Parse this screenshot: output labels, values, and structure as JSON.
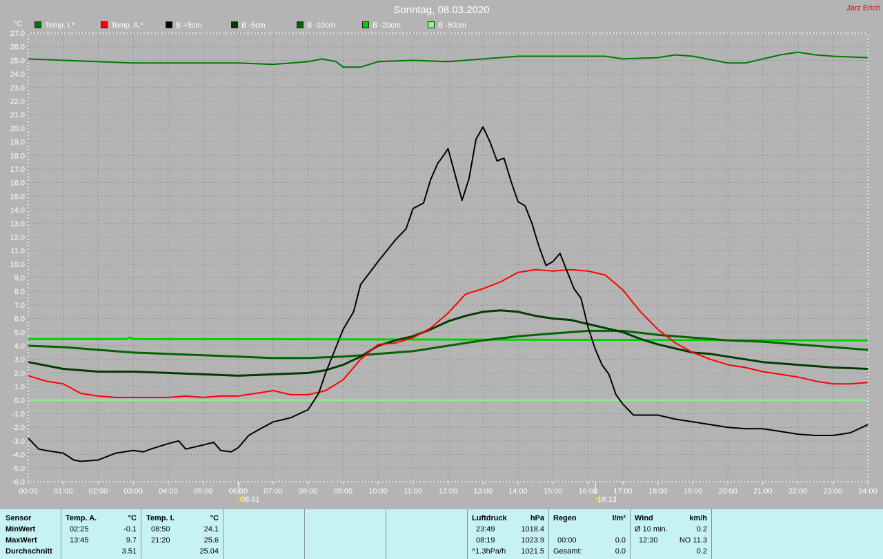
{
  "title": "Sonntag, 08.03.2020",
  "author": "Jarz Erich",
  "chart_data": {
    "type": "line",
    "ylabel": "°C",
    "ylim": [
      -6,
      27
    ],
    "yticks": [
      "27.0",
      "26.0",
      "25.0",
      "24.0",
      "23.0",
      "22.0",
      "21.0",
      "20.0",
      "19.0",
      "18.0",
      "17.0",
      "16.0",
      "15.0",
      "14.0",
      "13.0",
      "12.0",
      "11.0",
      "10.0",
      "9.0",
      "8.0",
      "7.0",
      "6.0",
      "5.0",
      "4.0",
      "3.0",
      "2.0",
      "1.0",
      "0.0",
      "-1.0",
      "-2.0",
      "-3.0",
      "-4.0",
      "-5.0",
      "-6.0"
    ],
    "xlim": [
      0,
      24
    ],
    "xticks": [
      "00:00",
      "01:00",
      "02:00",
      "03:00",
      "04:00",
      "05:00",
      "06:00",
      "07:00",
      "08:00",
      "09:00",
      "10:00",
      "11:00",
      "12:00",
      "13:00",
      "14:00",
      "15:00",
      "16:00",
      "17:00",
      "18:00",
      "19:00",
      "20:00",
      "21:00",
      "22:00",
      "23:00",
      "24:00"
    ],
    "grid": true,
    "sunrise": "06:01",
    "sunset": "16:13",
    "legend": [
      {
        "name": "Temp. I.*",
        "color": "#007800"
      },
      {
        "name": "Temp. A.*",
        "color": "#ff0000"
      },
      {
        "name": "B +5cm",
        "color": "#000000"
      },
      {
        "name": "B -5cm",
        "color": "#003c00"
      },
      {
        "name": "B -10cm",
        "color": "#006400"
      },
      {
        "name": "B -20cm",
        "color": "#00d000"
      },
      {
        "name": "B -50cm",
        "color": "#80ff80"
      }
    ],
    "series": [
      {
        "name": "Temp. I.*",
        "color": "#007800",
        "width": 2,
        "x": [
          0,
          1,
          2,
          3,
          4,
          5,
          6,
          7,
          8,
          8.4,
          8.8,
          9,
          9.5,
          10,
          11,
          12,
          12.5,
          13,
          14,
          15,
          16,
          16.5,
          17,
          18,
          18.5,
          19,
          20,
          20.5,
          21,
          21.5,
          22,
          22.5,
          23,
          24
        ],
        "values": [
          25.1,
          25,
          24.9,
          24.8,
          24.8,
          24.8,
          24.8,
          24.7,
          24.9,
          25.1,
          24.9,
          24.5,
          24.5,
          24.9,
          25,
          24.9,
          25,
          25.1,
          25.3,
          25.3,
          25.3,
          25.3,
          25.1,
          25.2,
          25.4,
          25.3,
          24.8,
          24.8,
          25.1,
          25.4,
          25.6,
          25.4,
          25.3,
          25.2
        ]
      },
      {
        "name": "Temp. A.*",
        "color": "#ff0000",
        "width": 2,
        "x": [
          0,
          0.5,
          1,
          1.5,
          2,
          2.5,
          3,
          3.5,
          4,
          4.5,
          5,
          5.5,
          6,
          6.5,
          7,
          7.5,
          8,
          8.5,
          9,
          9.5,
          10,
          10.5,
          11,
          11.5,
          12,
          12.5,
          13,
          13.5,
          14,
          14.5,
          15,
          15.5,
          16,
          16.5,
          17,
          17.5,
          18,
          18.5,
          19,
          19.5,
          20,
          20.5,
          21,
          21.5,
          22,
          22.5,
          23,
          23.5,
          24
        ],
        "values": [
          1.8,
          1.4,
          1.2,
          0.5,
          0.3,
          0.2,
          0.2,
          0.2,
          0.2,
          0.3,
          0.2,
          0.3,
          0.3,
          0.5,
          0.7,
          0.4,
          0.4,
          0.7,
          1.5,
          3.0,
          4.1,
          4.2,
          4.6,
          5.3,
          6.4,
          7.8,
          8.2,
          8.7,
          9.4,
          9.6,
          9.5,
          9.6,
          9.5,
          9.2,
          8.1,
          6.5,
          5.2,
          4.2,
          3.5,
          3.0,
          2.6,
          2.4,
          2.1,
          1.9,
          1.7,
          1.4,
          1.2,
          1.2,
          1.3
        ]
      },
      {
        "name": "B +5cm",
        "color": "#000000",
        "width": 2,
        "x": [
          0,
          0.3,
          0.5,
          1,
          1.3,
          1.5,
          2,
          2.3,
          2.5,
          3,
          3.3,
          3.5,
          4,
          4.3,
          4.5,
          5,
          5.3,
          5.5,
          5.8,
          6,
          6.3,
          6.5,
          7,
          7.5,
          8,
          8.3,
          8.5,
          9,
          9.3,
          9.5,
          10,
          10.5,
          10.8,
          11,
          11.3,
          11.5,
          11.7,
          11.9,
          12,
          12.2,
          12.4,
          12.6,
          12.8,
          13,
          13.2,
          13.4,
          13.6,
          13.8,
          14,
          14.2,
          14.4,
          14.6,
          14.8,
          15,
          15.2,
          15.4,
          15.6,
          15.8,
          16,
          16.2,
          16.4,
          16.6,
          16.8,
          17,
          17.3,
          17.6,
          18,
          18.5,
          19,
          19.5,
          20,
          20.5,
          21,
          21.5,
          22,
          22.5,
          23,
          23.5,
          24
        ],
        "values": [
          -2.8,
          -3.6,
          -3.7,
          -3.9,
          -4.4,
          -4.5,
          -4.4,
          -4.1,
          -3.9,
          -3.7,
          -3.8,
          -3.6,
          -3.2,
          -3,
          -3.6,
          -3.3,
          -3.1,
          -3.7,
          -3.8,
          -3.5,
          -2.6,
          -2.3,
          -1.6,
          -1.3,
          -0.7,
          0.5,
          2,
          5.2,
          6.5,
          8.5,
          10.2,
          11.8,
          12.6,
          14.1,
          14.5,
          16.2,
          17.4,
          18.1,
          18.5,
          16.6,
          14.7,
          16.3,
          19.2,
          20.1,
          19,
          17.6,
          17.8,
          16.1,
          14.6,
          14.3,
          13,
          11.3,
          9.9,
          10.2,
          10.8,
          9.5,
          8.2,
          7.5,
          5.4,
          3.8,
          2.6,
          1.9,
          0.4,
          -0.3,
          -1.1,
          -1.1,
          -1.1,
          -1.4,
          -1.6,
          -1.8,
          -2,
          -2.1,
          -2.1,
          -2.3,
          -2.5,
          -2.6,
          -2.6,
          -2.4,
          -1.8
        ]
      },
      {
        "name": "B -5cm",
        "color": "#003c00",
        "width": 3,
        "x": [
          0,
          1,
          2,
          3,
          4,
          5,
          6,
          7,
          8,
          8.5,
          9,
          9.5,
          10,
          10.5,
          11,
          11.5,
          12,
          12.5,
          13,
          13.5,
          14,
          14.5,
          15,
          15.5,
          16,
          16.5,
          17,
          17.5,
          18,
          18.5,
          19,
          19.5,
          20,
          20.5,
          21,
          22,
          23,
          24
        ],
        "values": [
          2.8,
          2.3,
          2.1,
          2.1,
          2,
          1.9,
          1.8,
          1.9,
          2.0,
          2.2,
          2.6,
          3.2,
          4.0,
          4.4,
          4.7,
          5.2,
          5.8,
          6.2,
          6.5,
          6.6,
          6.5,
          6.2,
          6.0,
          5.9,
          5.6,
          5.3,
          5.0,
          4.5,
          4.1,
          3.8,
          3.5,
          3.4,
          3.2,
          3.0,
          2.8,
          2.6,
          2.4,
          2.3
        ]
      },
      {
        "name": "B -10cm",
        "color": "#006400",
        "width": 3,
        "x": [
          0,
          1,
          2,
          3,
          4,
          5,
          6,
          7,
          8,
          9,
          10,
          11,
          12,
          13,
          14,
          15,
          16,
          17,
          18,
          19,
          20,
          21,
          22,
          23,
          24
        ],
        "values": [
          4.0,
          3.9,
          3.7,
          3.5,
          3.4,
          3.3,
          3.2,
          3.1,
          3.1,
          3.2,
          3.4,
          3.6,
          4.0,
          4.4,
          4.7,
          4.9,
          5.1,
          5.1,
          4.8,
          4.6,
          4.4,
          4.3,
          4.1,
          3.9,
          3.7
        ]
      },
      {
        "name": "B -20cm",
        "color": "#00d000",
        "width": 3,
        "x": [
          0,
          2.8,
          2.9,
          3.0,
          24
        ],
        "values": [
          4.5,
          4.5,
          4.6,
          4.5,
          4.4
        ]
      },
      {
        "name": "B -50cm",
        "color": "#80ff80",
        "width": 2,
        "x": [
          0,
          24
        ],
        "values": [
          0.0,
          0.0
        ]
      }
    ]
  },
  "table": {
    "sensor_header": "Sensor",
    "row_labels": [
      "MinWert",
      "MaxWert",
      "Durchschnitt"
    ],
    "temp_a": {
      "header": "Temp. A.",
      "unit": "°C",
      "min_time": "02:25",
      "min_val": "-0.1",
      "max_time": "13:45",
      "max_val": "9.7",
      "avg": "3.51"
    },
    "temp_i": {
      "header": "Temp. I.",
      "unit": "°C",
      "min_time": "08:50",
      "min_val": "24.1",
      "max_time": "21:20",
      "max_val": "25.6",
      "avg": "25.04"
    },
    "pressure": {
      "header": "Luftdruck",
      "unit": "hPa",
      "r1_time": "23:49",
      "r1_val": "1018.4",
      "r2_time": "08:19",
      "r2_val": "1023.9",
      "r3_label": "^1.3hPa/h",
      "r3_val": "1021.5"
    },
    "rain": {
      "header": "Regen",
      "unit": "l/m²",
      "r2_time": "00:00",
      "r2_val": "0.0",
      "r3_label": "Gesamt:",
      "r3_val": "0.0"
    },
    "wind": {
      "header": "Wind",
      "unit": "km/h",
      "r1_label": "Ø 10 min.",
      "r1_val": "0.2",
      "r2_time": "12:30",
      "r2_val": "NO 11.3",
      "r3_val": "0.2"
    }
  }
}
